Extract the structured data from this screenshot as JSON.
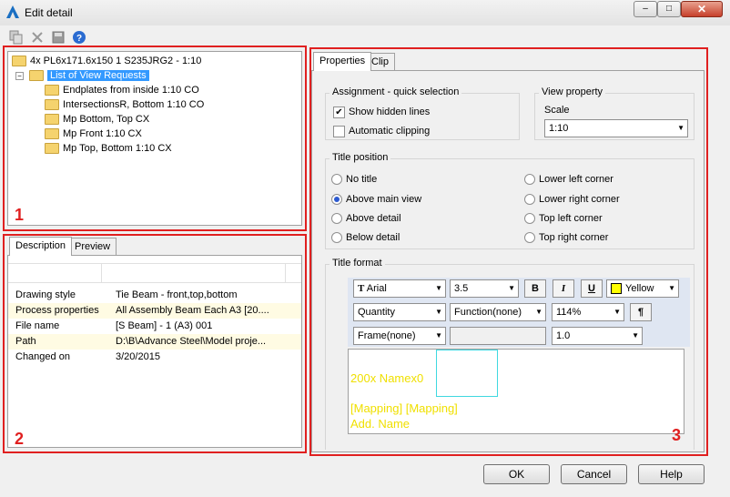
{
  "window": {
    "title": "Edit detail",
    "minimize": "–",
    "maximize": "□",
    "close": "✕"
  },
  "tree": {
    "root": "4x PL6x171.6x150 1 S235JRG2 - 1:10",
    "group": "List of View Requests",
    "items": [
      "Endplates from inside 1:10 CO",
      "IntersectionsR, Bottom 1:10 CO",
      "Mp Bottom, Top CX",
      "Mp Front 1:10 CX",
      "Mp Top, Bottom 1:10 CX"
    ]
  },
  "lower_tabs": [
    "Description",
    "Preview"
  ],
  "description": [
    {
      "label": "Drawing style",
      "value": "Tie Beam - front,top,bottom"
    },
    {
      "label": "Process properties",
      "value": "All Assembly Beam Each A3 [20...."
    },
    {
      "label": "File name",
      "value": "[S Beam] - 1 (A3) 001"
    },
    {
      "label": "Path",
      "value": "D:\\B\\Advance Steel\\Model proje..."
    },
    {
      "label": "Changed on",
      "value": "3/20/2015"
    }
  ],
  "region_labels": [
    "1",
    "2",
    "3"
  ],
  "right_tabs": [
    "Properties",
    "Clip"
  ],
  "assignment": {
    "title": "Assignment - quick selection",
    "show_hidden_lines": "Show hidden lines",
    "automatic_clipping": "Automatic clipping",
    "show_hidden_checked": "✔"
  },
  "view_property": {
    "title": "View property",
    "scale_label": "Scale",
    "scale_value": "1:10"
  },
  "title_position": {
    "title": "Title position",
    "left": [
      "No title",
      "Above main view",
      "Above detail",
      "Below detail"
    ],
    "right": [
      "Lower left corner",
      "Lower right corner",
      "Top left corner",
      "Top right corner"
    ],
    "selected": "Above main view"
  },
  "title_format": {
    "title": "Title format",
    "font": "Arial",
    "font_icon": "T",
    "size": "3.5",
    "bold": "B",
    "italic": "I",
    "underline": "U",
    "color": "Yellow",
    "color_hex": "#ffff00",
    "quantity": "Quantity",
    "function": "Function(none)",
    "percent": "114%",
    "para": "¶",
    "frame": "Frame(none)",
    "ratio": "1.0"
  },
  "preview_text": [
    "200x Namex0",
    "[Mapping] [Mapping]",
    "Add. Name"
  ],
  "buttons": {
    "ok": "OK",
    "cancel": "Cancel",
    "help": "Help"
  }
}
